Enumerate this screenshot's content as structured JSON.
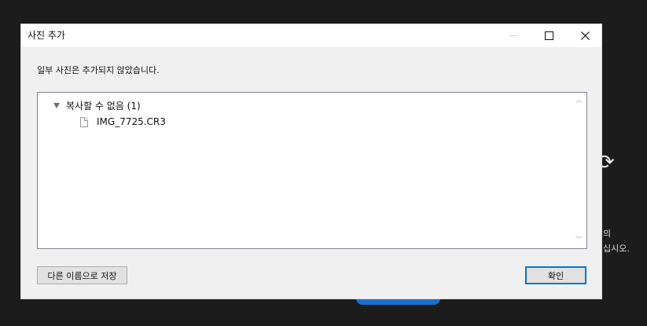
{
  "background": {
    "sync_icon": "sync-icon",
    "text_line_1": "의",
    "text_line_2": "십시오."
  },
  "dialog": {
    "title": "사진 추가",
    "message": "일부 사진은 추가되지 않았습니다.",
    "tree": {
      "group_label": "복사할 수 없음 (1)",
      "items": [
        "IMG_7725.CR3"
      ]
    },
    "buttons": {
      "save_as": "다른 이름으로 저장",
      "ok": "확인"
    }
  },
  "colors": {
    "accent": "#0078d7",
    "background_button": "#1a6fd0"
  }
}
